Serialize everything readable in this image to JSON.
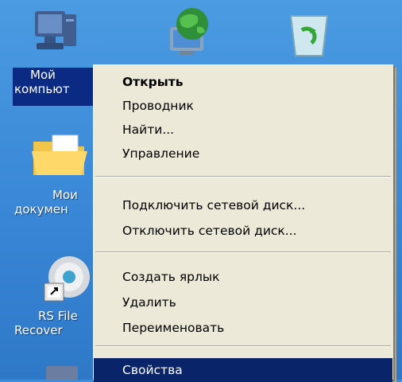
{
  "desktop": {
    "icons": [
      {
        "label_line1": "Мой",
        "label_line2": "компьют",
        "icon": "my-computer-icon"
      },
      {
        "icon": "network-places-icon"
      },
      {
        "icon": "recycle-bin-icon"
      },
      {
        "label_line1": "Мои",
        "label_line2": "докумен",
        "icon": "my-documents-icon"
      },
      {
        "label_line1": "RS File",
        "label_line2": "Recover",
        "icon": "rs-file-recovery-icon"
      }
    ]
  },
  "context_menu": {
    "items": [
      {
        "label": "Открыть",
        "bold": true
      },
      {
        "label": "Проводник"
      },
      {
        "label": "Найти..."
      },
      {
        "label": "Управление"
      },
      {
        "label": "Подключить сетевой диск..."
      },
      {
        "label": "Отключить сетевой диск..."
      },
      {
        "label": "Создать ярлык"
      },
      {
        "label": "Удалить"
      },
      {
        "label": "Переименовать"
      },
      {
        "label": "Свойства",
        "highlighted": true
      }
    ]
  },
  "colors": {
    "desktop": "#3a8fd8",
    "menu_bg": "#ece9d8",
    "highlight": "#0a246a"
  }
}
